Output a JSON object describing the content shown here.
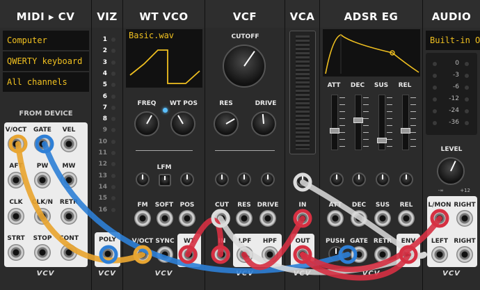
{
  "modules": {
    "midi": {
      "title": "MIDI ▸ CV",
      "driver": "Computer keyboard/mo",
      "device": "QWERTY keyboard (US)",
      "channel": "All channels",
      "section": "FROM DEVICE",
      "jacks": [
        "V/OCT",
        "GATE",
        "VEL",
        "AFT",
        "PW",
        "MW",
        "CLK",
        "CLK/N",
        "RETR",
        "STRT",
        "STOP",
        "CONT"
      ],
      "brand": "VCV"
    },
    "viz": {
      "title": "VIZ",
      "channels": [
        "1",
        "2",
        "3",
        "4",
        "5",
        "6",
        "7",
        "8",
        "9",
        "10",
        "11",
        "12",
        "13",
        "14",
        "15",
        "16"
      ],
      "input": "POLY",
      "brand": "VCV"
    },
    "wtvco": {
      "title": "WT VCO",
      "file": "Basic.wav",
      "knobs": [
        "FREQ",
        "WT POS",
        "LFM",
        "FM",
        "SOFT",
        "POS"
      ],
      "jacks": [
        "V/OCT",
        "SYNC",
        "WT"
      ],
      "brand": "VCV"
    },
    "vcf": {
      "title": "VCF",
      "knobs": [
        "CUTOFF",
        "RES",
        "DRIVE",
        "CUT",
        "RES",
        "DRIVE"
      ],
      "jacks": [
        "IN",
        "LPF",
        "HPF"
      ],
      "brand": "VCV"
    },
    "vca": {
      "title": "VCA",
      "jacks": [
        "IN",
        "OUT"
      ],
      "brand": "VCV"
    },
    "adsr": {
      "title": "ADSR EG",
      "sliders": [
        "ATT",
        "DEC",
        "SUS",
        "REL"
      ],
      "cv": [
        "ATT",
        "DEC",
        "SUS",
        "REL"
      ],
      "jacks": [
        "PUSH",
        "GATE",
        "RETR",
        "ENV"
      ],
      "brand": "VCV"
    },
    "audio": {
      "title": "AUDIO",
      "device": "Built-in Out",
      "meter": [
        "0",
        "-3",
        "-6",
        "-12",
        "-24",
        "-36"
      ],
      "level_label": "LEVEL",
      "level_min": "-∞",
      "level_max": "+12",
      "jacks": [
        "L/MON",
        "RIGHT",
        "LEFT",
        "RIGHT"
      ],
      "brand": "VCV"
    }
  },
  "colors": {
    "cable_yellow": "#e8a531",
    "cable_blue": "#2e7fd6",
    "cable_red": "#d63042",
    "cable_white": "#dcdcdc",
    "accent": "#f0c020"
  }
}
